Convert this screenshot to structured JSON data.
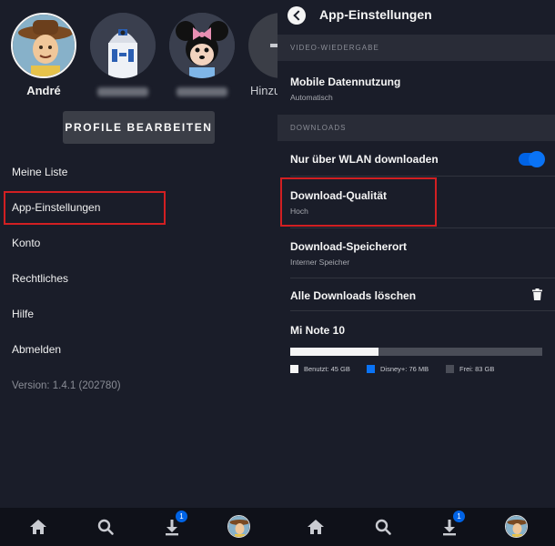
{
  "left": {
    "profiles": [
      {
        "name": "André",
        "avatar": "woody-avatar"
      },
      {
        "name": "",
        "avatar": "r2d2-avatar"
      },
      {
        "name": "",
        "avatar": "minnie-avatar"
      },
      {
        "name": "Hinzu",
        "avatar": "add-profile"
      }
    ],
    "edit_profiles_label": "PROFILE BEARBEITEN",
    "menu": [
      {
        "label": "Meine Liste"
      },
      {
        "label": "App-Einstellungen"
      },
      {
        "label": "Konto"
      },
      {
        "label": "Rechtliches"
      },
      {
        "label": "Hilfe"
      },
      {
        "label": "Abmelden"
      }
    ],
    "version": "Version: 1.4.1 (202780)"
  },
  "right": {
    "header_title": "App-Einstellungen",
    "section_video": "VIDEO-WIEDERGABE",
    "mobile_data": {
      "title": "Mobile Datennutzung",
      "sub": "Automatisch"
    },
    "section_downloads": "DOWNLOADS",
    "wifi_only": {
      "title": "Nur über WLAN downloaden",
      "enabled": true
    },
    "quality": {
      "title": "Download-Qualität",
      "sub": "Hoch"
    },
    "location": {
      "title": "Download-Speicherort",
      "sub": "Interner Speicher"
    },
    "delete_all": {
      "title": "Alle Downloads löschen"
    },
    "device": {
      "name": "Mi Note 10",
      "used_fraction": 0.35,
      "legend": [
        {
          "label": "Benutzt: 45 GB",
          "color": "#f5f5f5"
        },
        {
          "label": "Disney+: 76 MB",
          "color": "#0a73f5"
        },
        {
          "label": "Frei: 83 GB",
          "color": "#4a4d57"
        }
      ]
    }
  },
  "nav": {
    "downloads_badge": "1"
  },
  "colors": {
    "accent": "#0063e5",
    "highlight": "#d21f22",
    "background": "#1a1d29"
  }
}
